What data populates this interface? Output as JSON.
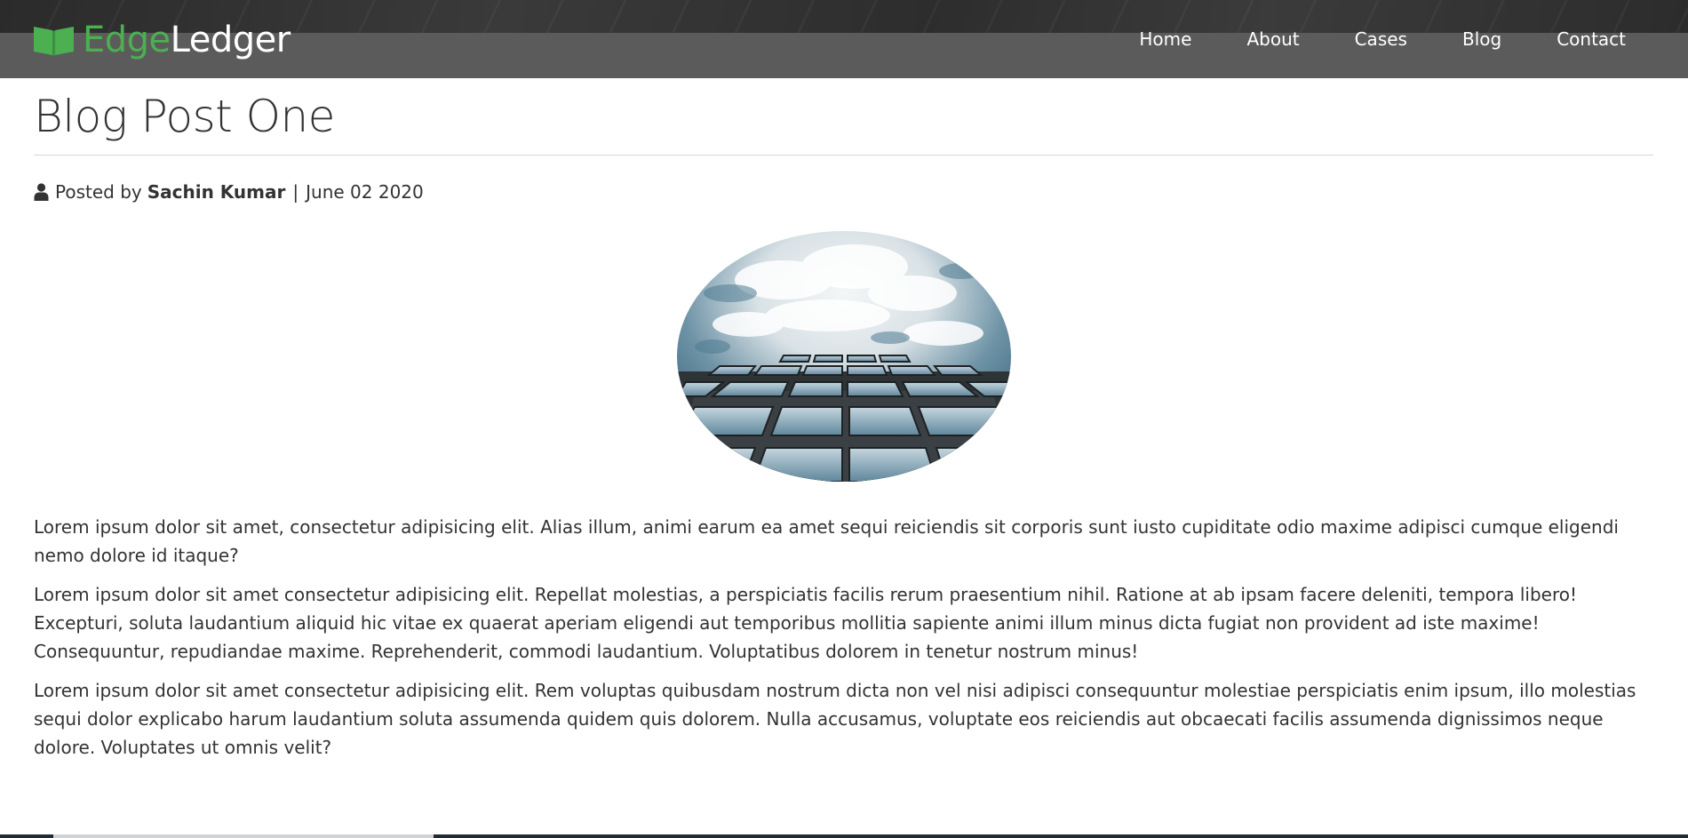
{
  "brand": {
    "part1": "Edge",
    "part2": "Ledger",
    "icon": "open-book-icon",
    "accent": "#4caf50"
  },
  "nav": {
    "items": [
      {
        "label": "Home"
      },
      {
        "label": "About"
      },
      {
        "label": "Cases"
      },
      {
        "label": "Blog"
      },
      {
        "label": "Contact"
      }
    ]
  },
  "post": {
    "title": "Blog Post One",
    "meta": {
      "icon": "user-icon",
      "prefix": "Posted by",
      "author": "Sachin Kumar",
      "separator": "|",
      "date": "June 02 2020"
    },
    "image": {
      "icon": "building-sky-image"
    },
    "paragraphs": [
      "Lorem ipsum dolor sit amet, consectetur adipisicing elit. Alias illum, animi earum ea amet sequi reiciendis sit corporis sunt iusto cupiditate odio maxime adipisci cumque eligendi nemo dolore id itaque?",
      "Lorem ipsum dolor sit amet consectetur adipisicing elit. Repellat molestias, a perspiciatis facilis rerum praesentium nihil. Ratione at ab ipsam facere deleniti, tempora libero! Excepturi, soluta laudantium aliquid hic vitae ex quaerat aperiam eligendi aut temporibus mollitia sapiente animi illum minus dicta fugiat non provident ad iste maxime! Consequuntur, repudiandae maxime. Reprehenderit, commodi laudantium. Voluptatibus dolorem in tenetur nostrum minus!",
      "Lorem ipsum dolor sit amet consectetur adipisicing elit. Rem voluptas quibusdam nostrum dicta non vel nisi adipisci consequuntur molestiae perspiciatis enim ipsum, illo molestias sequi dolor explicabo harum laudantium soluta assumenda quidem quis dolorem. Nulla accusamus, voluptate eos reiciendis aut obcaecati facilis assumenda dignissimos neque dolore. Voluptates ut omnis velit?"
    ]
  }
}
